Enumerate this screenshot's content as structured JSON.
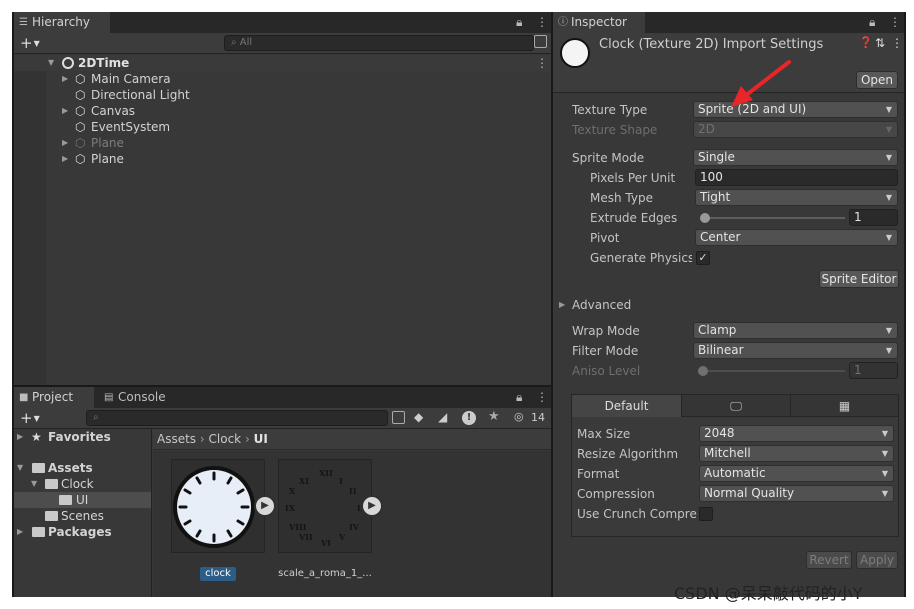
{
  "hierarchy": {
    "tab_label": "Hierarchy",
    "search_placeholder": "All",
    "scene": {
      "name": "2DTime"
    },
    "items": [
      {
        "label": "Main Camera",
        "expandable": true,
        "dim": false
      },
      {
        "label": "Directional Light",
        "expandable": false,
        "dim": false
      },
      {
        "label": "Canvas",
        "expandable": true,
        "dim": false
      },
      {
        "label": "EventSystem",
        "expandable": false,
        "dim": false
      },
      {
        "label": "Plane",
        "expandable": true,
        "dim": true
      },
      {
        "label": "Plane",
        "expandable": true,
        "dim": false
      }
    ]
  },
  "project": {
    "tabs": [
      {
        "label": "Project"
      },
      {
        "label": "Console"
      }
    ],
    "hidden_count": "14",
    "tree": {
      "favorites": "Favorites",
      "assets": "Assets",
      "clock": "Clock",
      "ui": "UI",
      "scenes": "Scenes",
      "packages": "Packages"
    },
    "breadcrumb": [
      "Assets",
      "Clock",
      "UI"
    ],
    "assets": [
      {
        "name": "clock"
      },
      {
        "name": "scale_a_roma_1_..."
      }
    ]
  },
  "inspector": {
    "tab_label": "Inspector",
    "title": "Clock (Texture 2D) Import Settings",
    "open_button": "Open",
    "fields": {
      "texture_type": {
        "label": "Texture Type",
        "value": "Sprite (2D and UI)"
      },
      "texture_shape": {
        "label": "Texture Shape",
        "value": "2D"
      },
      "sprite_mode": {
        "label": "Sprite Mode",
        "value": "Single"
      },
      "pixels_per_unit": {
        "label": "Pixels Per Unit",
        "value": "100"
      },
      "mesh_type": {
        "label": "Mesh Type",
        "value": "Tight"
      },
      "extrude_edges": {
        "label": "Extrude Edges",
        "value": "1",
        "fraction": 0
      },
      "pivot": {
        "label": "Pivot",
        "value": "Center"
      },
      "generate_physics": {
        "label": "Generate Physics S",
        "checked": true
      },
      "advanced": {
        "label": "Advanced"
      },
      "wrap_mode": {
        "label": "Wrap Mode",
        "value": "Clamp"
      },
      "filter_mode": {
        "label": "Filter Mode",
        "value": "Bilinear"
      },
      "aniso_level": {
        "label": "Aniso Level",
        "value": "1",
        "fraction": 0
      }
    },
    "sprite_editor_button": "Sprite Editor",
    "platform": {
      "tab_default": "Default",
      "max_size": {
        "label": "Max Size",
        "value": "2048"
      },
      "resize_algorithm": {
        "label": "Resize Algorithm",
        "value": "Mitchell"
      },
      "format": {
        "label": "Format",
        "value": "Automatic"
      },
      "compression": {
        "label": "Compression",
        "value": "Normal Quality"
      },
      "use_crunch": {
        "label": "Use Crunch Compres",
        "checked": false
      }
    },
    "revert_button": "Revert",
    "apply_button": "Apply"
  },
  "watermark": "CSDN @呆呆敲代码的小Y",
  "colors": {
    "annotation_arrow": "#e8262a",
    "selection": "#2c5d87",
    "clock_face": "#e8eef8"
  }
}
